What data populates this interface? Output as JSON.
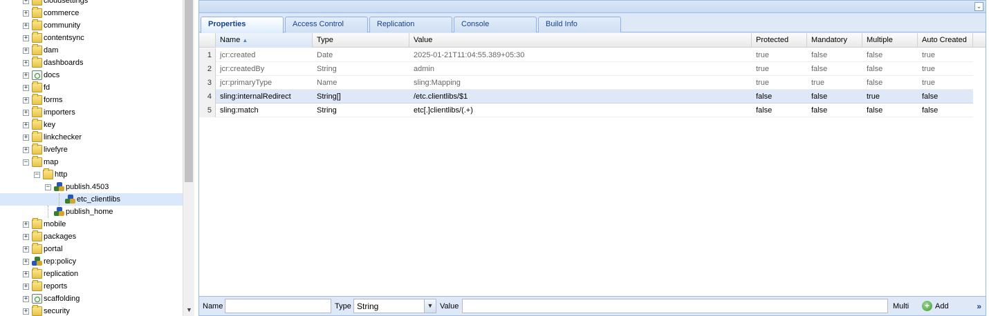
{
  "tree": {
    "items": [
      {
        "label": "cloudsettings",
        "icon": "folder-icon",
        "depth": 0,
        "toggle": "+"
      },
      {
        "label": "commerce",
        "icon": "folder-icon",
        "depth": 0,
        "toggle": "+"
      },
      {
        "label": "community",
        "icon": "folder-icon",
        "depth": 0,
        "toggle": "+"
      },
      {
        "label": "contentsync",
        "icon": "folder-icon",
        "depth": 0,
        "toggle": "+"
      },
      {
        "label": "dam",
        "icon": "folder-icon",
        "depth": 0,
        "toggle": "+"
      },
      {
        "label": "dashboards",
        "icon": "folder-icon",
        "depth": 0,
        "toggle": "+"
      },
      {
        "label": "docs",
        "icon": "docs-node-icon",
        "depth": 0,
        "toggle": "+"
      },
      {
        "label": "fd",
        "icon": "folder-icon",
        "depth": 0,
        "toggle": "+"
      },
      {
        "label": "forms",
        "icon": "folder-icon",
        "depth": 0,
        "toggle": "+"
      },
      {
        "label": "importers",
        "icon": "folder-icon",
        "depth": 0,
        "toggle": "+"
      },
      {
        "label": "key",
        "icon": "folder-icon",
        "depth": 0,
        "toggle": "+"
      },
      {
        "label": "linkchecker",
        "icon": "folder-icon",
        "depth": 0,
        "toggle": "+"
      },
      {
        "label": "livefyre",
        "icon": "folder-icon",
        "depth": 0,
        "toggle": "+"
      },
      {
        "label": "map",
        "icon": "folder-icon",
        "depth": 0,
        "toggle": "−"
      },
      {
        "label": "http",
        "icon": "folder-icon",
        "depth": 1,
        "toggle": "−"
      },
      {
        "label": "publish.4503",
        "icon": "mapping-icon",
        "depth": 2,
        "toggle": "−"
      },
      {
        "label": "etc_clientlibs",
        "icon": "mapping-icon",
        "depth": 3,
        "toggle": "",
        "selected": true
      },
      {
        "label": "publish_home",
        "icon": "mapping-icon",
        "depth": 2,
        "toggle": ""
      },
      {
        "label": "mobile",
        "icon": "folder-icon",
        "depth": 0,
        "toggle": "+"
      },
      {
        "label": "packages",
        "icon": "folder-icon",
        "depth": 0,
        "toggle": "+"
      },
      {
        "label": "portal",
        "icon": "folder-icon",
        "depth": 0,
        "toggle": "+"
      },
      {
        "label": "rep:policy",
        "icon": "policy-icon",
        "depth": 0,
        "toggle": "+"
      },
      {
        "label": "replication",
        "icon": "folder-icon",
        "depth": 0,
        "toggle": "+"
      },
      {
        "label": "reports",
        "icon": "folder-icon",
        "depth": 0,
        "toggle": "+"
      },
      {
        "label": "scaffolding",
        "icon": "docs-node-icon",
        "depth": 0,
        "toggle": "+"
      },
      {
        "label": "security",
        "icon": "folder-icon",
        "depth": 0,
        "toggle": "+"
      }
    ]
  },
  "tabs": [
    {
      "label": "Properties",
      "active": true
    },
    {
      "label": "Access Control",
      "active": false
    },
    {
      "label": "Replication",
      "active": false
    },
    {
      "label": "Console",
      "active": false
    },
    {
      "label": "Build Info",
      "active": false
    }
  ],
  "grid": {
    "columns": [
      "Name",
      "Type",
      "Value",
      "Protected",
      "Mandatory",
      "Multiple",
      "Auto Created"
    ],
    "sort_indicator": "▲",
    "rows": [
      {
        "num": "1",
        "name": "jcr:created",
        "type": "Date",
        "value": "2025-01-21T11:04:55.389+05:30",
        "protected": "true",
        "mandatory": "false",
        "multiple": "false",
        "auto_created": "true"
      },
      {
        "num": "2",
        "name": "jcr:createdBy",
        "type": "String",
        "value": "admin",
        "protected": "true",
        "mandatory": "false",
        "multiple": "false",
        "auto_created": "true"
      },
      {
        "num": "3",
        "name": "jcr:primaryType",
        "type": "Name",
        "value": "sling:Mapping",
        "protected": "true",
        "mandatory": "true",
        "multiple": "false",
        "auto_created": "true"
      },
      {
        "num": "4",
        "name": "sling:internalRedirect",
        "type": "String[]",
        "value": "/etc.clientlibs/$1",
        "protected": "false",
        "mandatory": "false",
        "multiple": "true",
        "auto_created": "false"
      },
      {
        "num": "5",
        "name": "sling:match",
        "type": "String",
        "value": "etc[.]clientlibs/(.+)",
        "protected": "false",
        "mandatory": "false",
        "multiple": "false",
        "auto_created": "false"
      }
    ]
  },
  "bottom_bar": {
    "name_label": "Name",
    "name_value": "",
    "type_label": "Type",
    "type_value": "String",
    "value_label": "Value",
    "value_value": "",
    "multi_label": "Multi",
    "add_label": "Add",
    "more_glyph": "»"
  },
  "icons": {
    "collapse": "collapse-icon",
    "dropdown": "chevron-down-icon",
    "add": "plus-circle-icon"
  }
}
